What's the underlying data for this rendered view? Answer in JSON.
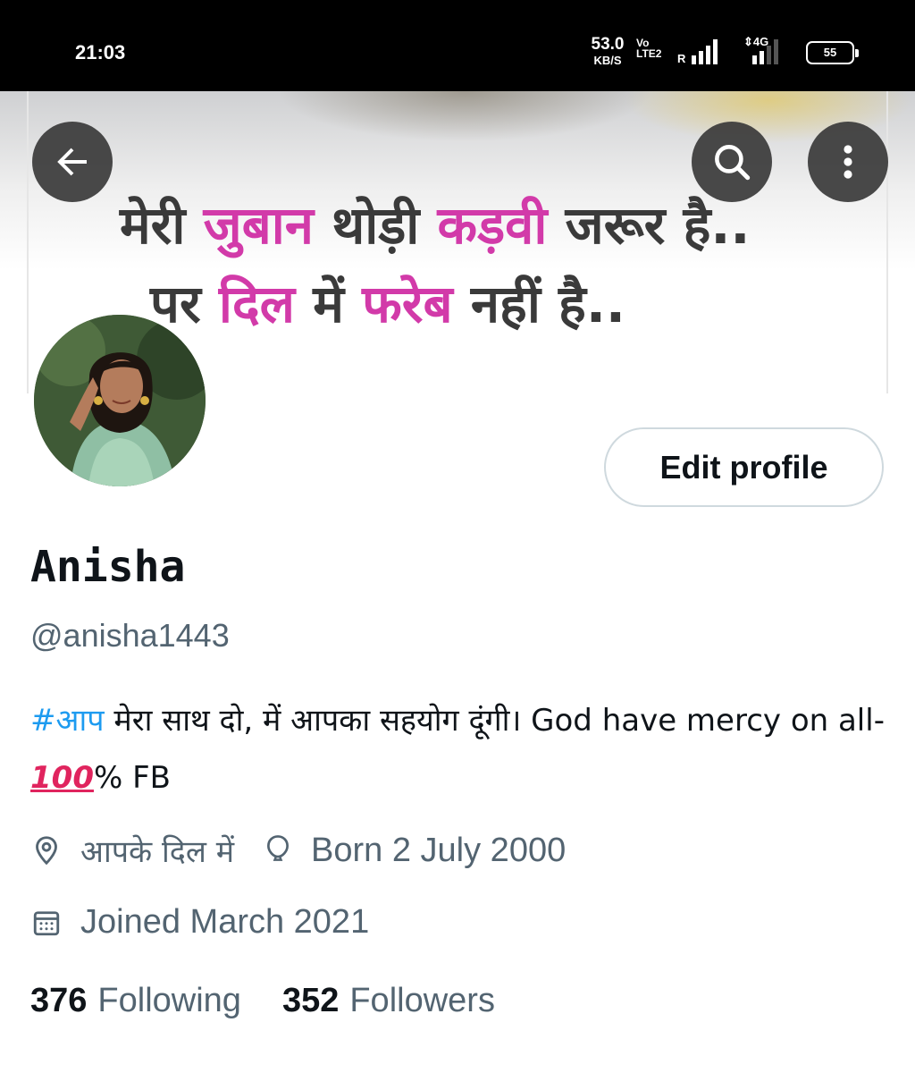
{
  "status_bar": {
    "time": "21:03",
    "net_speed_value": "53.0",
    "net_speed_unit": "KB/S",
    "volte_top": "Vo",
    "volte_bottom": "LTE2",
    "roaming": "R",
    "network_type": "4G",
    "battery_level": "55"
  },
  "banner": {
    "line1": [
      "मेरी ",
      "जुबान",
      " थोड़ी ",
      "कड़वी",
      " जरूर है.."
    ],
    "line2": [
      "पर ",
      "दिल",
      " में ",
      "फरेब",
      " नहीं है.."
    ]
  },
  "profile": {
    "name": "Anisha",
    "handle": "@anisha1443",
    "edit_label": "Edit profile",
    "bio_hashtag": "#आप",
    "bio_text": " मेरा साथ दो, में आपका सहयोग दूंगी। God have mercy on all-",
    "bio_hundred": "100",
    "bio_tail": "% FB",
    "location": "आपके दिल में",
    "birthday": "Born 2 July 2000",
    "joined": "Joined March 2021",
    "following_count": "376",
    "following_label": "Following",
    "followers_count": "352",
    "followers_label": "Followers"
  },
  "colors": {
    "accent": "#1d9bf0",
    "banner_highlight": "#d23aa9",
    "secondary_text": "#536471"
  },
  "icons": [
    "arrow-left-icon",
    "search-icon",
    "more-vertical-icon",
    "location-pin-icon",
    "balloon-icon",
    "calendar-icon"
  ]
}
